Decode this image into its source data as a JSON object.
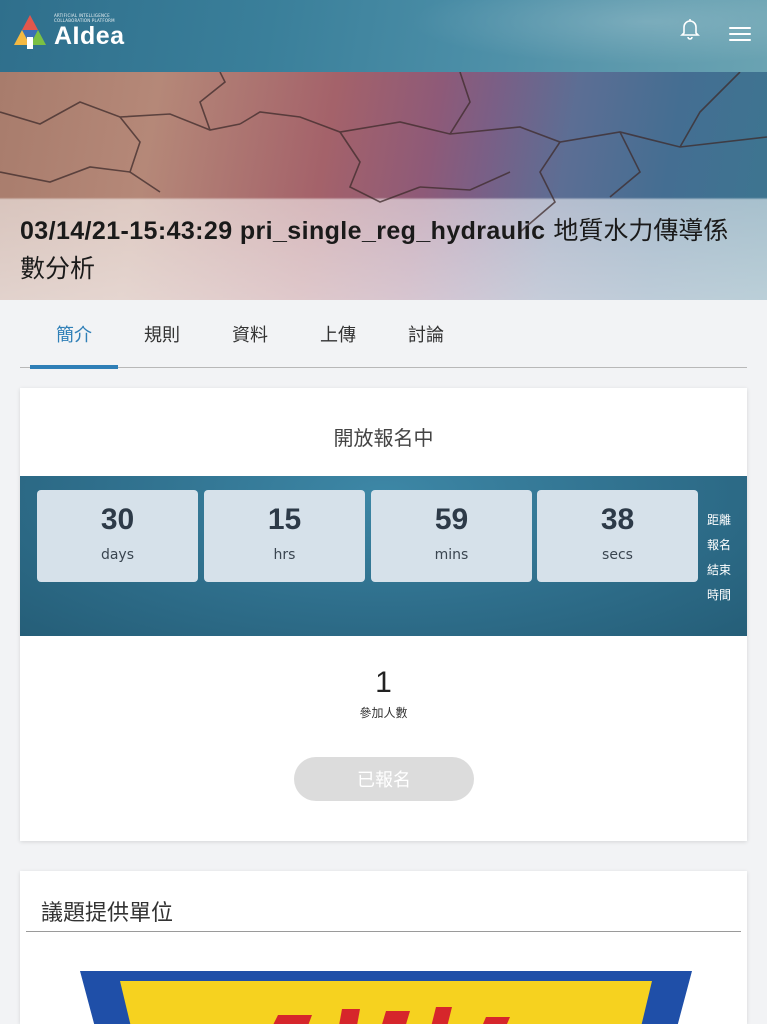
{
  "header": {
    "logo": {
      "tagline": "ARTIFICIAL INTELLIGENCE COLLABORATION PLATFORM",
      "name": "AIdea"
    },
    "icons": [
      "bell-icon",
      "hamburger-menu-icon"
    ]
  },
  "banner": {
    "title_en": "03/14/21-15:43:29 pri_single_reg_hydraulic",
    "title_zh": "地質水力傳導係數分析"
  },
  "tabs": [
    {
      "label": "簡介",
      "active": true
    },
    {
      "label": "規則",
      "active": false
    },
    {
      "label": "資料",
      "active": false
    },
    {
      "label": "上傳",
      "active": false
    },
    {
      "label": "討論",
      "active": false
    }
  ],
  "competition": {
    "status": "開放報名中",
    "countdown": {
      "days": {
        "value": "30",
        "unit": "days"
      },
      "hrs": {
        "value": "15",
        "unit": "hrs"
      },
      "mins": {
        "value": "59",
        "unit": "mins"
      },
      "secs": {
        "value": "38",
        "unit": "secs"
      },
      "label_lines": [
        "距離",
        "報名",
        "結束",
        "時間"
      ]
    },
    "participants": {
      "count": "1",
      "label": "參加人數"
    },
    "register_button": "已報名"
  },
  "organizer": {
    "title": "議題提供單位"
  },
  "colors": {
    "accent": "#2f7fb7",
    "header_bg": "#3a7f9a",
    "countdown_bg": "#2f6f8c",
    "countdown_box": "#d6e1ea",
    "button_disabled": "#dcdcdc"
  }
}
